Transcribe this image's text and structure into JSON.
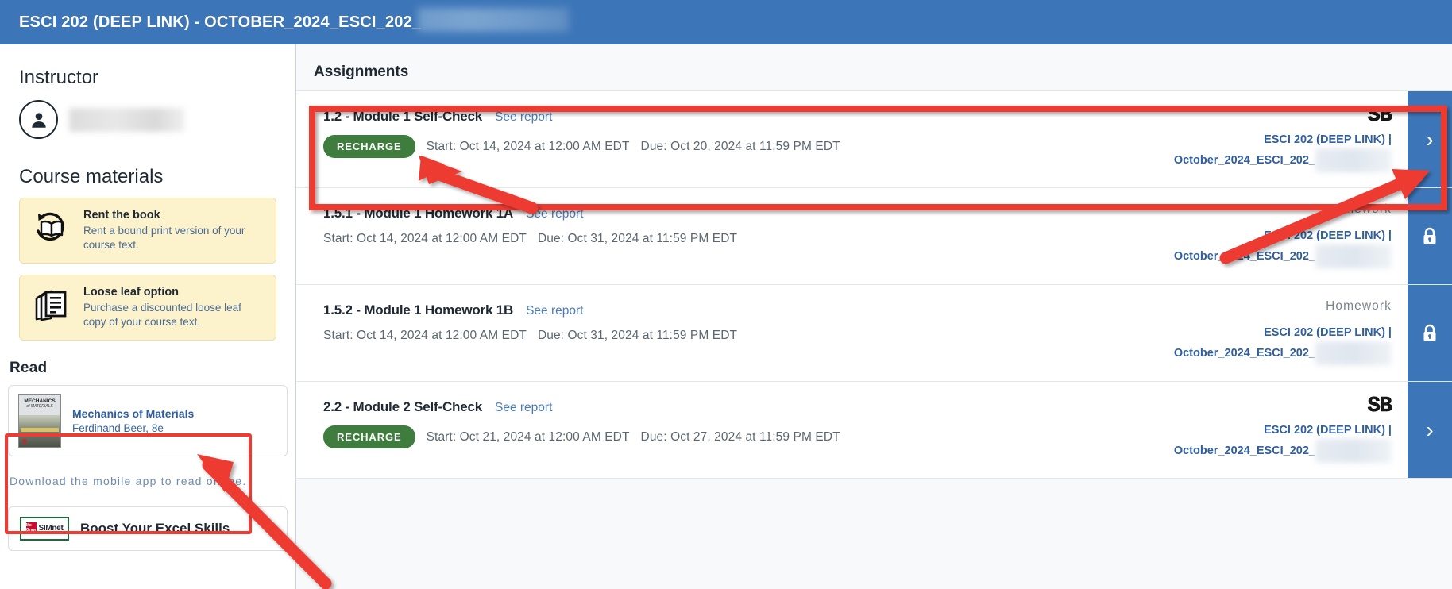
{
  "header": {
    "title": "ESCI 202 (DEEP LINK) - OCTOBER_2024_ESCI_202_",
    "bg_color": "#3d76b8",
    "has_redacted_suffix": true
  },
  "sidebar": {
    "instructor": {
      "heading": "Instructor",
      "avatar_icon": "user-avatar-icon",
      "name_redacted": true
    },
    "course_materials": {
      "heading": "Course materials",
      "cards": [
        {
          "icon": "book-rent-icon",
          "title": "Rent the book",
          "description": "Rent a bound print version of your course text."
        },
        {
          "icon": "loose-leaf-pages-icon",
          "title": "Loose leaf option",
          "description": "Purchase a discounted loose leaf copy of your course text."
        }
      ]
    },
    "read": {
      "heading": "Read",
      "book": {
        "cover_title": "MECHANICS",
        "cover_subtitle": "of MATERIALS",
        "title": "Mechanics of Materials",
        "author": "Ferdinand Beer, 8e"
      },
      "highlighted": true,
      "highlight_color": "#ee3b33"
    },
    "mobile_note": "Download the mobile app to read offline.",
    "promo": {
      "logo_mark": "SIMnet",
      "logo_brand": "McGraw Hill",
      "title": "Boost Your Excel Skills"
    }
  },
  "main": {
    "title": "Assignments",
    "highlight_color": "#ee3b33",
    "assignments": [
      {
        "name": "1.2 - Module 1 Self-Check",
        "report_link": "See report",
        "badge": "RECHARGE",
        "start": "Start: Oct 14, 2024 at 12:00 AM EDT",
        "due": "Due: Oct 20, 2024 at 11:59 PM EDT",
        "logo": "SB",
        "type": "",
        "course_link": "ESCI 202 (DEEP LINK) |",
        "section_link": "October_2024_ESCI_202_",
        "redacted_suffix": true,
        "action_icon": "chevron-right-icon",
        "highlighted": true
      },
      {
        "name": "1.5.1 - Module 1 Homework 1A",
        "report_link": "See report",
        "badge": "",
        "start": "Start: Oct 14, 2024 at 12:00 AM EDT",
        "due": "Due: Oct 31, 2024 at 11:59 PM EDT",
        "logo": "",
        "type": "Homework",
        "course_link": "ESCI 202 (DEEP LINK) |",
        "section_link": "October_2024_ESCI_202_",
        "redacted_suffix": true,
        "action_icon": "lock-icon",
        "highlighted": false
      },
      {
        "name": "1.5.2 - Module 1 Homework 1B",
        "report_link": "See report",
        "badge": "",
        "start": "Start: Oct 14, 2024 at 12:00 AM EDT",
        "due": "Due: Oct 31, 2024 at 11:59 PM EDT",
        "logo": "",
        "type": "Homework",
        "course_link": "ESCI 202 (DEEP LINK) |",
        "section_link": "October_2024_ESCI_202_",
        "redacted_suffix": true,
        "action_icon": "lock-icon",
        "highlighted": false
      },
      {
        "name": "2.2 - Module 2 Self-Check",
        "report_link": "See report",
        "badge": "RECHARGE",
        "start": "Start: Oct 21, 2024 at 12:00 AM EDT",
        "due": "Due: Oct 27, 2024 at 11:59 PM EDT",
        "logo": "SB",
        "type": "",
        "course_link": "ESCI 202 (DEEP LINK) |",
        "section_link": "October_2024_ESCI_202_",
        "redacted_suffix": true,
        "action_icon": "chevron-right-icon",
        "highlighted": false
      }
    ]
  },
  "annotations": {
    "color": "#ee3b33",
    "arrows": [
      {
        "name": "arrow-to-recharge-badge",
        "points_at": "RECHARGE badge of first assignment"
      },
      {
        "name": "arrow-to-chevron-button",
        "points_at": "chevron action button of first assignment"
      },
      {
        "name": "arrow-to-read-book",
        "points_at": "Mechanics of Materials book in Read section"
      }
    ],
    "boxes": [
      {
        "name": "highlight-box-first-assignment"
      },
      {
        "name": "highlight-box-read-section"
      }
    ]
  }
}
